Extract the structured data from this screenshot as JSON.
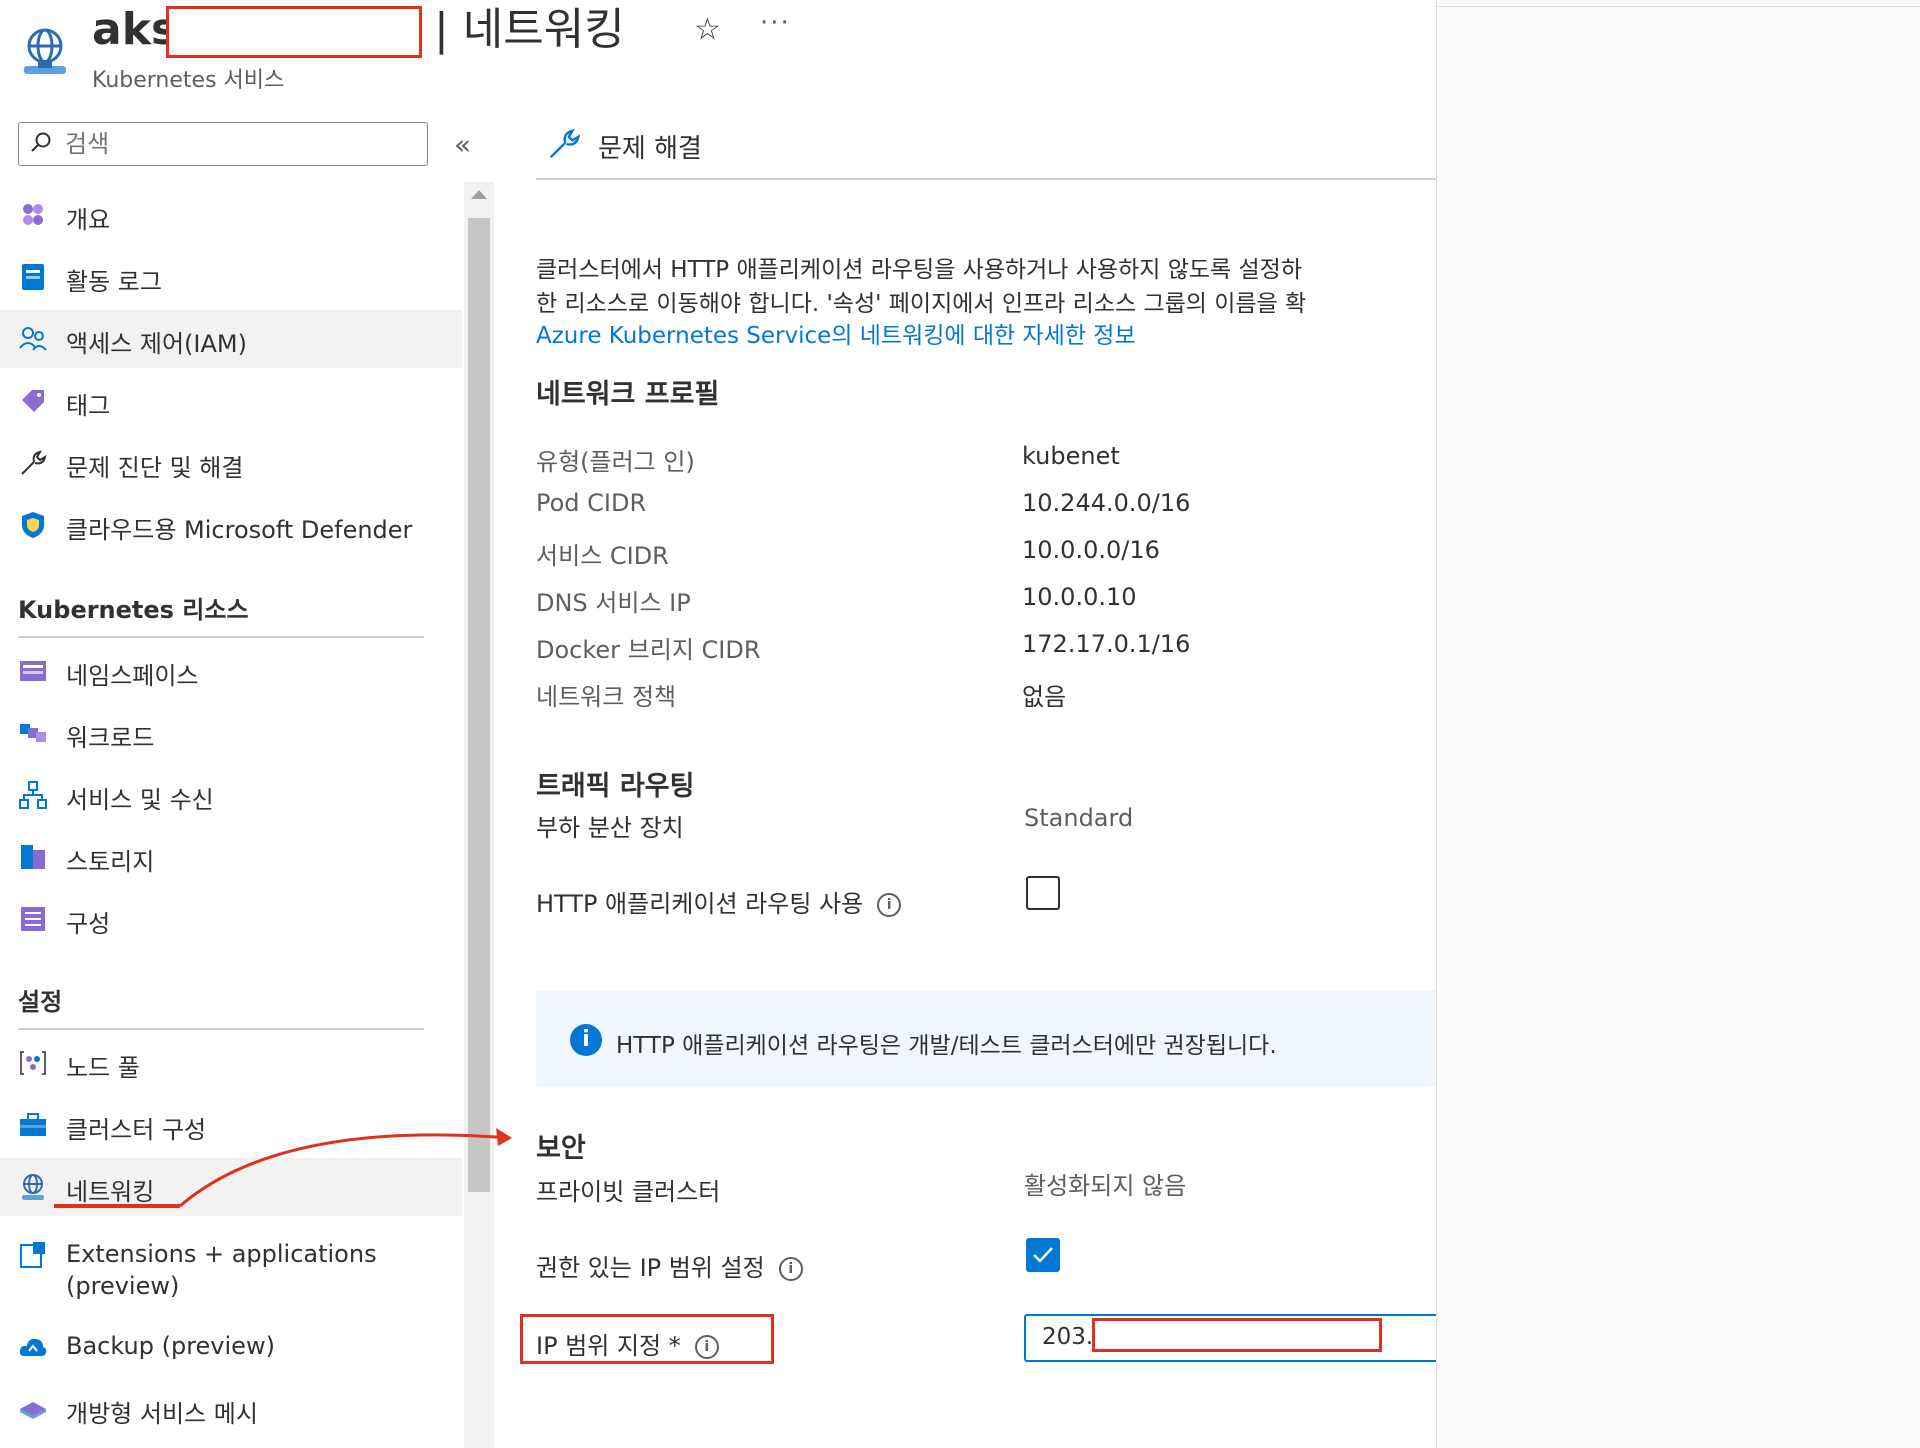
{
  "header": {
    "title_prefix": "aks",
    "title_suffix": "| 네트워킹",
    "subtitle": "Kubernetes 서비스",
    "favorite_glyph": "☆",
    "more_glyph": "···",
    "icon": "kubernetes-network-icon"
  },
  "search": {
    "placeholder": "검색",
    "collapse_glyph": "«"
  },
  "sidebar": {
    "items": [
      {
        "label": "개요",
        "icon": "overview-icon"
      },
      {
        "label": "활동 로그",
        "icon": "activity-log-icon"
      },
      {
        "label": "액세스 제어(IAM)",
        "icon": "iam-icon"
      },
      {
        "label": "태그",
        "icon": "tag-icon"
      },
      {
        "label": "문제 진단 및 해결",
        "icon": "wrench-icon"
      },
      {
        "label": "클라우드용 Microsoft Defender",
        "icon": "defender-shield-icon"
      }
    ],
    "section_k8s": "Kubernetes 리소스",
    "k8s_items": [
      {
        "label": "네임스페이스",
        "icon": "namespace-icon"
      },
      {
        "label": "워크로드",
        "icon": "workload-icon"
      },
      {
        "label": "서비스 및 수신",
        "icon": "services-icon"
      },
      {
        "label": "스토리지",
        "icon": "storage-icon"
      },
      {
        "label": "구성",
        "icon": "configuration-icon"
      }
    ],
    "section_settings": "설정",
    "settings_items": [
      {
        "label": "노드 풀",
        "icon": "node-pool-icon"
      },
      {
        "label": "클러스터 구성",
        "icon": "cluster-config-icon"
      },
      {
        "label": "네트워킹",
        "icon": "networking-icon",
        "selected": true
      },
      {
        "label": "Extensions + applications",
        "label2": "(preview)",
        "icon": "extensions-icon"
      },
      {
        "label": "Backup (preview)",
        "icon": "backup-icon"
      },
      {
        "label": "개방형 서비스 메시",
        "icon": "service-mesh-icon"
      }
    ]
  },
  "toolbar": {
    "troubleshoot_label": "문제 해결"
  },
  "main": {
    "description_line1": "클러스터에서 HTTP 애플리케이션 라우팅을 사용하거나 사용하지 않도록 설정하",
    "description_line2": "한 리소스로 이동해야 합니다. '속성' 페이지에서 인프라 리소스 그룹의 이름을 확",
    "learn_more_link": "Azure Kubernetes Service의 네트워킹에 대한 자세한 정보",
    "network_profile": {
      "heading": "네트워크 프로필",
      "rows": [
        {
          "key": "유형(플러그 인)",
          "value": "kubenet"
        },
        {
          "key": "Pod CIDR",
          "value": "10.244.0.0/16"
        },
        {
          "key": "서비스 CIDR",
          "value": "10.0.0.0/16"
        },
        {
          "key": "DNS 서비스 IP",
          "value": "10.0.0.10"
        },
        {
          "key": "Docker 브리지 CIDR",
          "value": "172.17.0.1/16"
        },
        {
          "key": "네트워크 정책",
          "value": "없음"
        }
      ]
    },
    "traffic_routing": {
      "heading": "트래픽 라우팅",
      "load_balancer_label": "부하 분산 장치",
      "load_balancer_value": "Standard",
      "http_routing_label": "HTTP 애플리케이션 라우팅 사용",
      "http_routing_checked": false
    },
    "info_bar": {
      "text": "HTTP 애플리케이션 라우팅은 개발/테스트 클러스터에만 권장됩니다.",
      "icon": "info-icon"
    },
    "security": {
      "heading": "보안",
      "private_cluster_label": "프라이빗 클러스터",
      "private_cluster_value": "활성화되지 않음",
      "authorized_ip_label": "권한 있는 IP 범위 설정",
      "authorized_ip_checked": true,
      "ip_range_label": "IP 범위 지정 *",
      "ip_range_value": "203.2"
    }
  },
  "colors": {
    "accent": "#0078d4",
    "annotation_red": "#e0301e",
    "selected_bg": "#f3f2f1"
  }
}
